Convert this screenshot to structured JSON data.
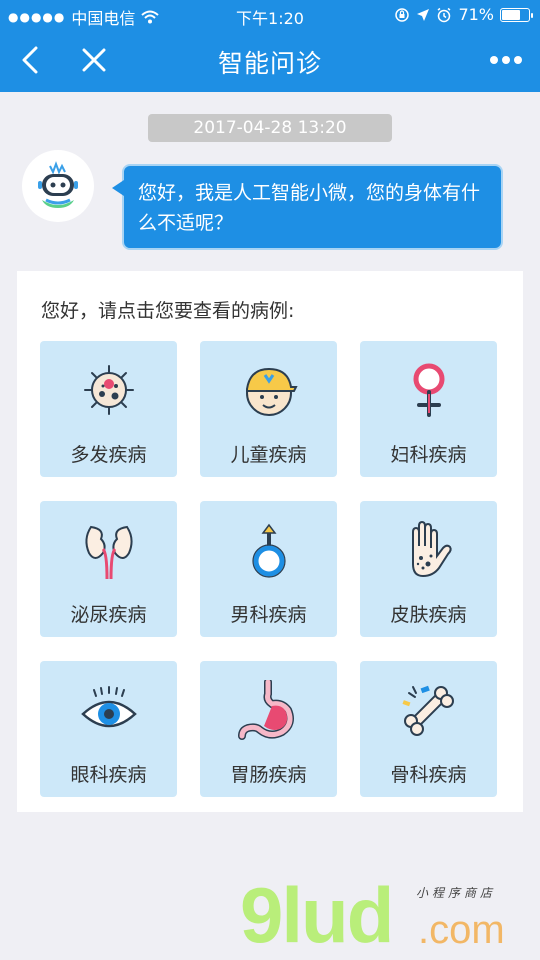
{
  "status_bar": {
    "carrier": "中国电信",
    "time": "下午1:20",
    "battery": "71%",
    "battery_level": 0.71,
    "icons": [
      "signal-dots-icon",
      "wifi-icon",
      "orientation-lock-icon",
      "location-icon",
      "alarm-icon",
      "battery-icon"
    ]
  },
  "nav": {
    "title": "智能问诊",
    "icons": [
      "back-chevron-icon",
      "close-icon",
      "more-dots-icon"
    ]
  },
  "chat": {
    "timestamp": "2017-04-28 13:20",
    "bot_avatar_icon": "robot-avatar-icon",
    "message": "您好，我是人工智能小微，您的身体有什么不适呢？"
  },
  "card": {
    "prompt": "您好，请点击您要查看的病例:",
    "categories": [
      {
        "label": "多发疾病",
        "icon": "virus-icon"
      },
      {
        "label": "儿童疾病",
        "icon": "child-face-icon"
      },
      {
        "label": "妇科疾病",
        "icon": "female-symbol-icon"
      },
      {
        "label": "泌尿疾病",
        "icon": "kidney-icon"
      },
      {
        "label": "男科疾病",
        "icon": "male-symbol-icon"
      },
      {
        "label": "皮肤疾病",
        "icon": "hand-skin-icon"
      },
      {
        "label": "眼科疾病",
        "icon": "eye-icon"
      },
      {
        "label": "胃肠疾病",
        "icon": "stomach-icon"
      },
      {
        "label": "骨科疾病",
        "icon": "bone-icon"
      }
    ]
  },
  "watermark": {
    "brand": "9lud",
    "tld": ".com",
    "subtitle": "小程序商店"
  },
  "colors": {
    "primary": "#1e8fe4",
    "cell_bg": "#cde8f9",
    "page_bg": "#efeff4",
    "timestamp_bg": "#c8c8c8"
  }
}
